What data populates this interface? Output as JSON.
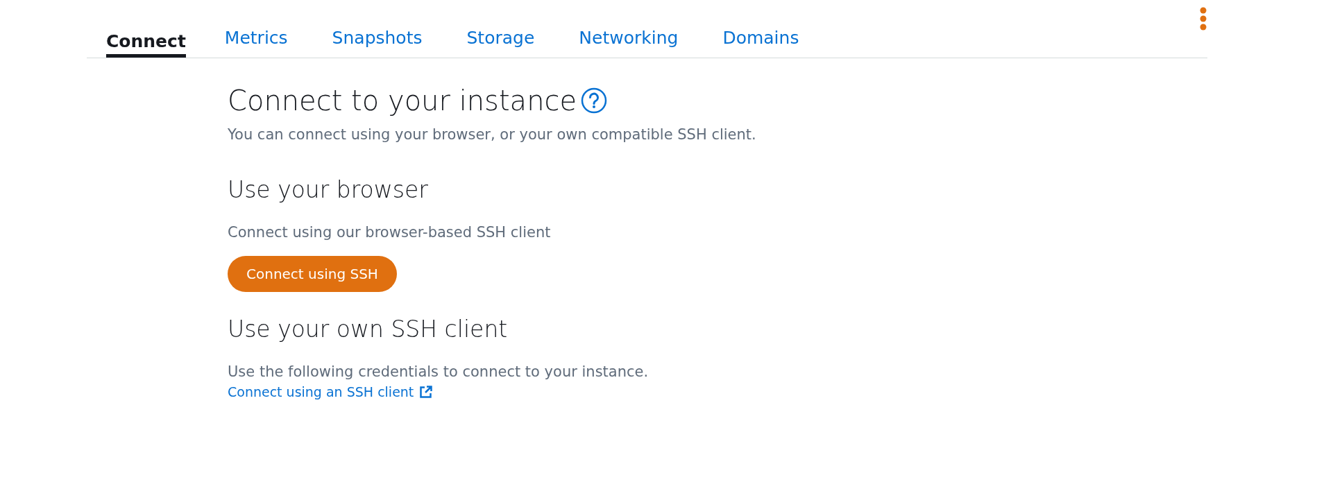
{
  "tabs": [
    {
      "label": "Connect",
      "selected": true
    },
    {
      "label": "Metrics",
      "selected": false
    },
    {
      "label": "Snapshots",
      "selected": false
    },
    {
      "label": "Storage",
      "selected": false
    },
    {
      "label": "Networking",
      "selected": false
    },
    {
      "label": "Domains",
      "selected": false
    }
  ],
  "heading": "Connect to your instance",
  "intro": "You can connect using your browser, or your own compatible SSH client.",
  "browser_section": {
    "heading": "Use your browser",
    "text": "Connect using our browser-based SSH client",
    "button": "Connect using SSH"
  },
  "client_section": {
    "heading": "Use your own SSH client",
    "text": "Use the following credentials to connect to your instance.",
    "link": "Connect using an SSH client"
  }
}
